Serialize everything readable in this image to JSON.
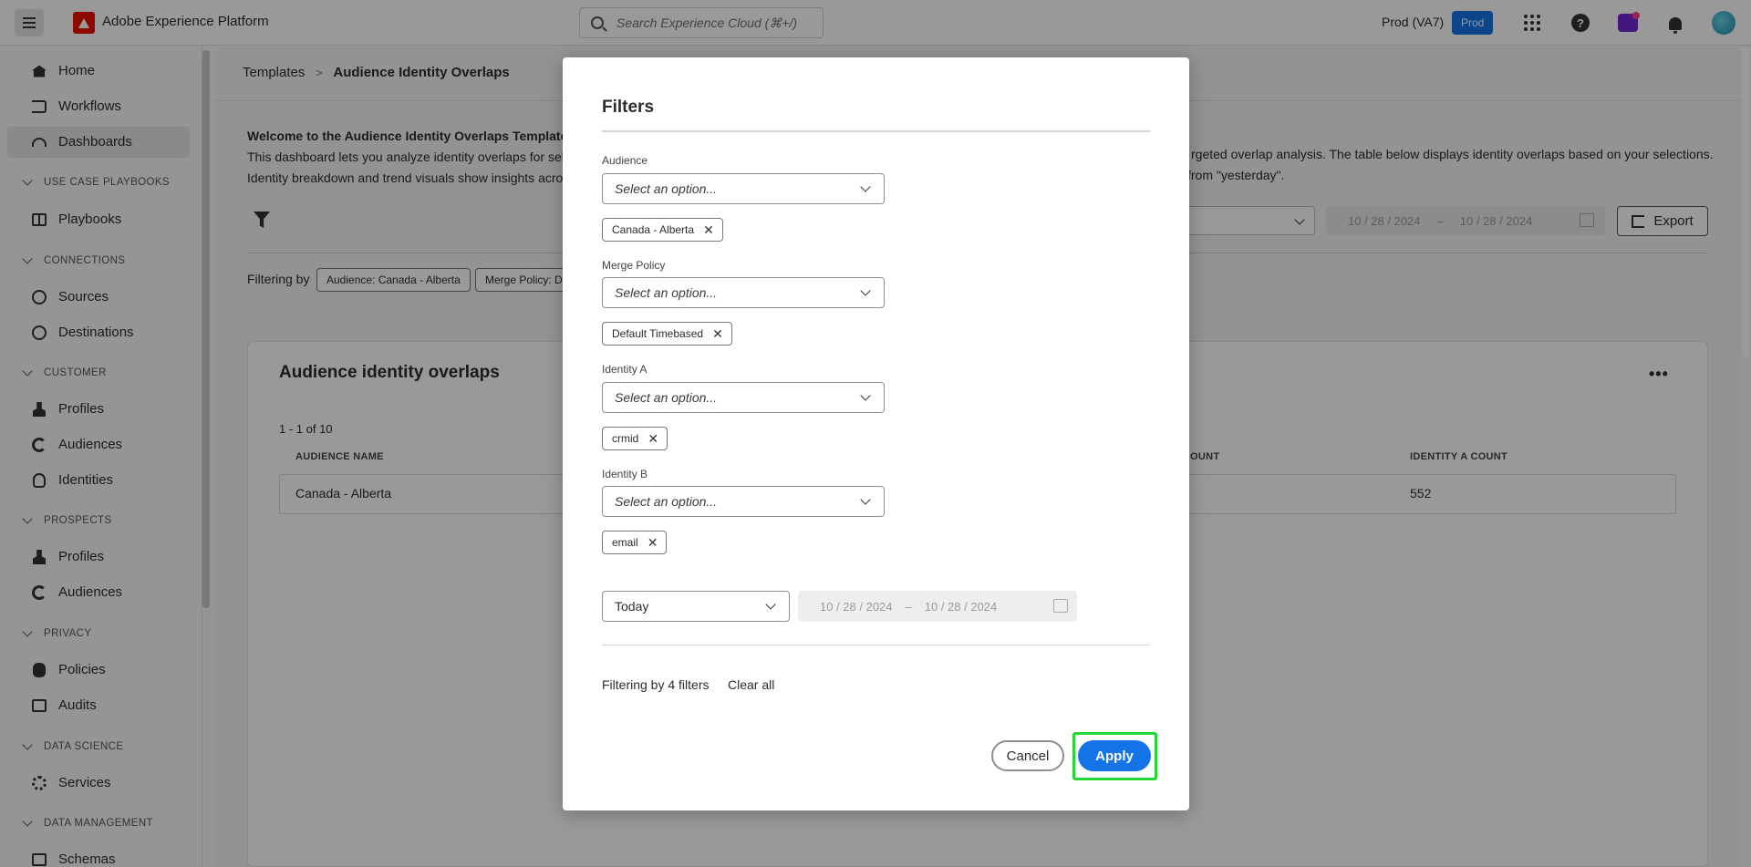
{
  "topbar": {
    "app_title": "Adobe Experience Platform",
    "search_placeholder": "Search Experience Cloud (⌘+/)",
    "org_label": "Prod (VA7)",
    "sandbox_badge": "Prod"
  },
  "sidebar": {
    "items": [
      {
        "label": "Home",
        "icon": "home-icon"
      },
      {
        "label": "Workflows",
        "icon": "workflows-icon"
      },
      {
        "label": "Dashboards",
        "icon": "dashboard-icon",
        "active": true
      },
      {
        "label": "Playbooks",
        "icon": "playbook-icon"
      },
      {
        "label": "Sources",
        "icon": "sources-icon"
      },
      {
        "label": "Destinations",
        "icon": "destinations-icon"
      },
      {
        "label": "Profiles",
        "icon": "user-icon"
      },
      {
        "label": "Audiences",
        "icon": "audiences-icon"
      },
      {
        "label": "Identities",
        "icon": "fingerprint-icon"
      },
      {
        "label": "Profiles",
        "icon": "user-icon"
      },
      {
        "label": "Audiences",
        "icon": "audiences-icon"
      },
      {
        "label": "Policies",
        "icon": "hand-icon"
      },
      {
        "label": "Audits",
        "icon": "audit-icon"
      },
      {
        "label": "Services",
        "icon": "gear-icon"
      },
      {
        "label": "Schemas",
        "icon": "schema-icon"
      }
    ],
    "sections": [
      "USE CASE PLAYBOOKS",
      "CONNECTIONS",
      "CUSTOMER",
      "PROSPECTS",
      "PRIVACY",
      "DATA SCIENCE",
      "DATA MANAGEMENT"
    ]
  },
  "main": {
    "breadcrumb": {
      "parent": "Templates",
      "separator": ">",
      "current": "Audience Identity Overlaps"
    },
    "welcome_title": "Welcome to the Audience Identity Overlaps Template.",
    "welcome_line1": "This dashboard lets you analyze identity overlaps for sele",
    "welcome_line2": "Identity breakdown and trend visuals show insights acros",
    "welcome_right1": "rgeted overlap analysis. The table below displays identity overlaps based on your selections.",
    "welcome_right2": "from \"yesterday\".",
    "bg_date_start": "10 / 28 / 2024",
    "bg_date_end": "10 / 28 / 2024",
    "bg_date_sep": "–",
    "export_label": "Export",
    "filtering_by": "Filtering by",
    "chips": [
      "Audience: Canada - Alberta",
      "Merge Policy: De"
    ],
    "card_title": "Audience identity overlaps",
    "more": "•••",
    "count": "1 - 1 of 10",
    "columns": [
      "AUDIENCE NAME",
      "OUNT",
      "IDENTITY A COUNT"
    ],
    "row": {
      "audience_name": "Canada - Alberta",
      "identity_a_count": "552"
    }
  },
  "dialog": {
    "title": "Filters",
    "audience": {
      "label": "Audience",
      "placeholder": "Select an option...",
      "tag": "Canada - Alberta"
    },
    "merge_policy": {
      "label": "Merge Policy",
      "placeholder": "Select an option...",
      "tag": "Default Timebased"
    },
    "identity_a": {
      "label": "Identity A",
      "placeholder": "Select an option...",
      "tag": "crmid"
    },
    "identity_b": {
      "label": "Identity B",
      "placeholder": "Select an option...",
      "tag": "email"
    },
    "range": "Today",
    "date_start": "10 / 28 / 2024",
    "date_end": "10 / 28 / 2024",
    "date_sep": "–",
    "filter_count": "Filtering by 4 filters",
    "clear_all": "Clear all",
    "cancel": "Cancel",
    "apply": "Apply",
    "remove_glyph": "✕"
  },
  "colors": {
    "accent": "#1473e6",
    "highlight": "#22d933",
    "adobe_red": "#eb1000"
  }
}
